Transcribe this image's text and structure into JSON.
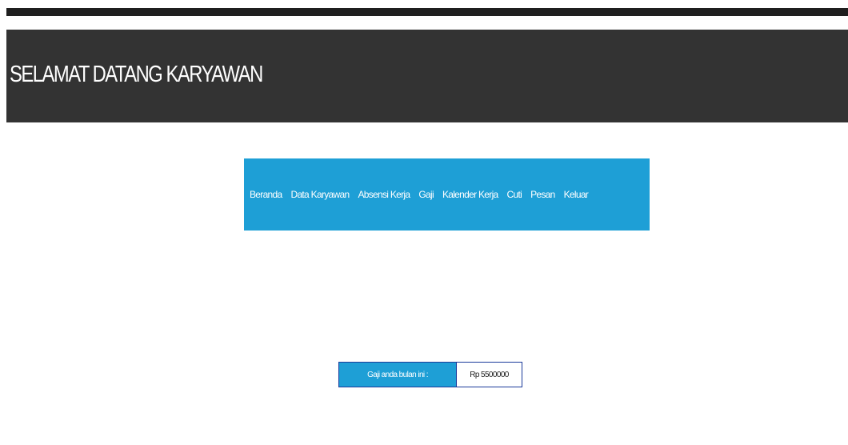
{
  "header": {
    "title": "SELAMAT DATANG KARYAWAN"
  },
  "nav": {
    "items": [
      {
        "label": "Beranda"
      },
      {
        "label": "Data Karyawan"
      },
      {
        "label": "Absensi Kerja"
      },
      {
        "label": "Gaji"
      },
      {
        "label": "Kalender Kerja"
      },
      {
        "label": "Cuti"
      },
      {
        "label": "Pesan"
      },
      {
        "label": "Keluar"
      }
    ]
  },
  "salary": {
    "label": "Gaji anda bulan ini :",
    "value": "Rp 5500000"
  },
  "colors": {
    "header_bg": "#333333",
    "nav_bg": "#1e9fd6",
    "table_border": "#1a3a9a"
  }
}
